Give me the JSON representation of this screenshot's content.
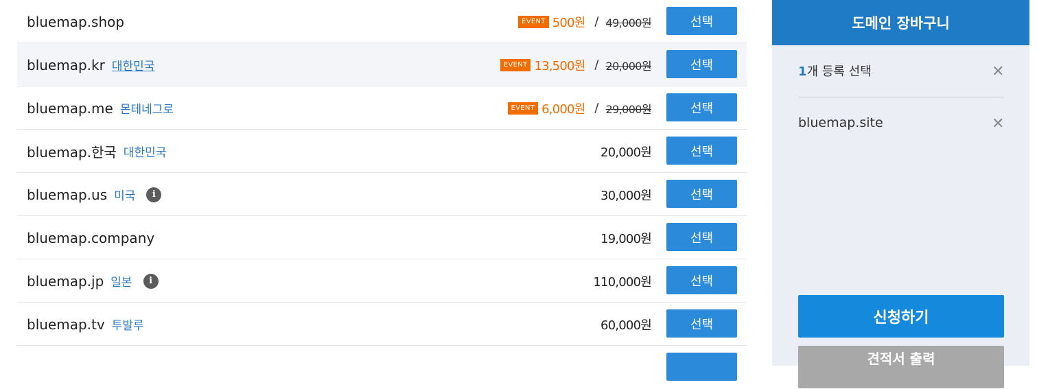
{
  "currency_suffix": "원",
  "select_label": "선택",
  "event_badge": "EVENT",
  "domains": [
    {
      "name": "bluemap.shop",
      "country": "",
      "sale": "500원",
      "original": "49,000원"
    },
    {
      "name": "bluemap.kr",
      "country": "대한민국",
      "sale": "13,500원",
      "original": "20,000원"
    },
    {
      "name": "bluemap.me",
      "country": "몬테네그로",
      "sale": "6,000원",
      "original": "29,000원"
    },
    {
      "name": "bluemap.한국",
      "country": "대한민국",
      "price": "20,000원"
    },
    {
      "name": "bluemap.us",
      "country": "미국",
      "info": "i",
      "price": "30,000원"
    },
    {
      "name": "bluemap.company",
      "country": "",
      "price": "19,000원"
    },
    {
      "name": "bluemap.jp",
      "country": "일본",
      "info": "i",
      "price": "110,000원"
    },
    {
      "name": "bluemap.tv",
      "country": "투발루",
      "price": "60,000원"
    }
  ],
  "slash": "/",
  "cart": {
    "title": "도메인 장바구니",
    "count": "1",
    "count_text": "개 등록 선택",
    "items": [
      "bluemap.site"
    ],
    "apply_label": "신청하기",
    "quote_label": "견적서 출력",
    "remove_glyph": "✕"
  },
  "colors": {
    "accent_blue": "#2b8ad9",
    "header_blue": "#1f7bc6",
    "event_orange": "#f26d00",
    "cart_bg": "#ebeff5"
  }
}
